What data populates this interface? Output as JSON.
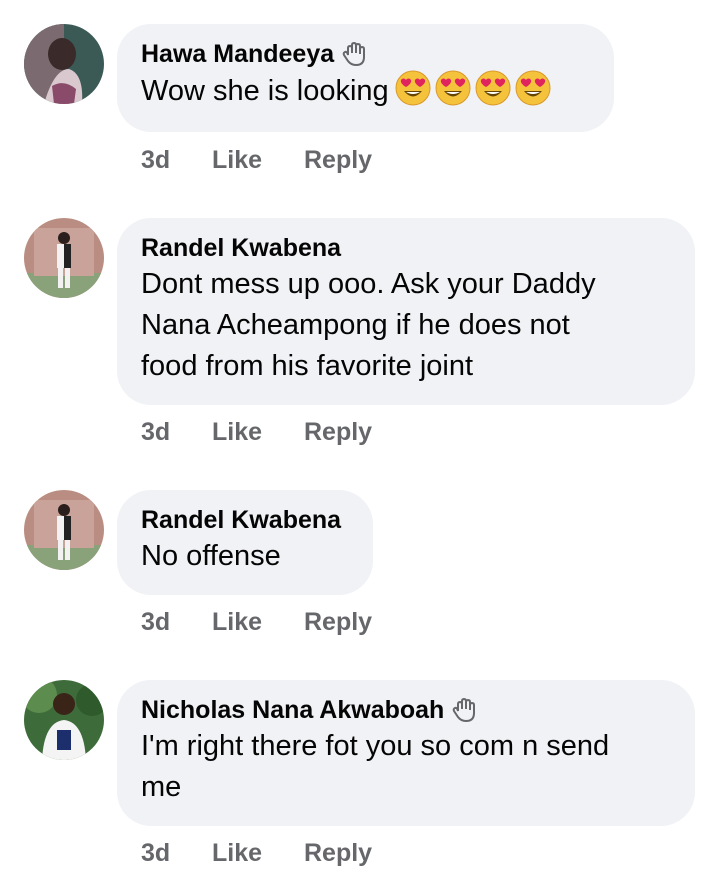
{
  "comments": [
    {
      "name": "Hawa Mandeeya",
      "badge": "wave-icon",
      "text": "Wow she is looking",
      "emoji": "heart-eyes-emoji",
      "emoji_count": 4,
      "time": "3d",
      "like": "Like",
      "reply": "Reply"
    },
    {
      "name": "Randel Kwabena",
      "text": "Dont mess up ooo. Ask your Daddy\nNana Acheampong if he does not\nfood from his favorite joint",
      "time": "3d",
      "like": "Like",
      "reply": "Reply"
    },
    {
      "name": "Randel Kwabena",
      "text": "No offense",
      "time": "3d",
      "like": "Like",
      "reply": "Reply"
    },
    {
      "name": "Nicholas Nana Akwaboah",
      "badge": "wave-icon",
      "text": "I'm right there fot you so com n send\nme",
      "time": "3d",
      "like": "Like",
      "reply": "Reply"
    }
  ],
  "colors": {
    "bubble": "#f0f2f5",
    "meta_text": "#65676b",
    "name_text": "#050505"
  }
}
